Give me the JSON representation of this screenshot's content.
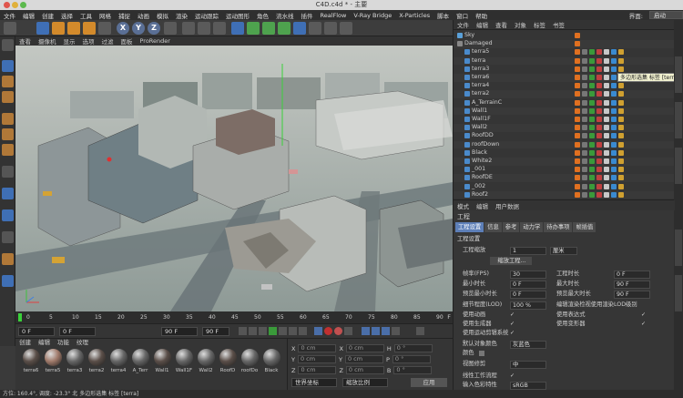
{
  "window": {
    "title": "C4D.c4d * - 主要"
  },
  "menubar": {
    "items": [
      "文件",
      "编辑",
      "创建",
      "选择",
      "工具",
      "网格",
      "捕捉",
      "动画",
      "模拟",
      "渲染",
      "运动跟踪",
      "运动图形",
      "角色",
      "流水线",
      "插件",
      "RealFlow",
      "V-Ray Bridge",
      "X-Particles",
      "脚本",
      "窗口",
      "帮助"
    ],
    "layout_label": "界面:",
    "layout_value": "启动"
  },
  "toolbar": {
    "axis_x": "X",
    "axis_y": "Y",
    "axis_z": "Z"
  },
  "viewport": {
    "menu": [
      "查看",
      "摄像机",
      "显示",
      "选项",
      "过滤",
      "面板",
      "ProRender"
    ]
  },
  "timeline": {
    "ticks": [
      "0",
      "5",
      "10",
      "15",
      "20",
      "25",
      "30",
      "35",
      "40",
      "45",
      "50",
      "55",
      "60",
      "65",
      "70",
      "75",
      "80",
      "85",
      "90"
    ],
    "frame_unit": "F"
  },
  "transport": {
    "start": "0 F",
    "current": "0 F",
    "end": "90 F",
    "end2": "90 F"
  },
  "materials": {
    "menu": [
      "创建",
      "编辑",
      "功能",
      "纹理"
    ],
    "items": [
      "terra6",
      "terra5",
      "terra3",
      "terra2",
      "terra4",
      "A_Terr",
      "Wall1",
      "Wall1F",
      "Wall2",
      "RoofD",
      "roofDo",
      "Black"
    ]
  },
  "coords": {
    "rows": [
      {
        "l1": "X",
        "v1": "0 cm",
        "l2": "X",
        "v2": "0 cm",
        "l3": "H",
        "v3": "0 °"
      },
      {
        "l1": "Y",
        "v1": "0 cm",
        "l2": "Y",
        "v2": "0 cm",
        "l3": "P",
        "v3": "0 °"
      },
      {
        "l1": "Z",
        "v1": "0 cm",
        "l2": "Z",
        "v2": "0 cm",
        "l3": "B",
        "v3": "0 °"
      }
    ],
    "mode": "世界坐标",
    "scale_mode": "缩放比例",
    "apply": "应用"
  },
  "objects": {
    "menu": [
      "文件",
      "编辑",
      "查看",
      "对象",
      "标签",
      "书签"
    ],
    "rows": [
      {
        "name": "Sky",
        "indent": 0
      },
      {
        "name": "Damaged",
        "indent": 0
      },
      {
        "name": "terra5",
        "indent": 1
      },
      {
        "name": "terra",
        "indent": 1
      },
      {
        "name": "terra3",
        "indent": 1
      },
      {
        "name": "terra6",
        "indent": 1
      },
      {
        "name": "terra4",
        "indent": 1
      },
      {
        "name": "terra2",
        "indent": 1
      },
      {
        "name": "A_TerrainC",
        "indent": 1
      },
      {
        "name": "Wall1",
        "indent": 1
      },
      {
        "name": "Wall1F",
        "indent": 1
      },
      {
        "name": "Wall2",
        "indent": 1
      },
      {
        "name": "RoofDD",
        "indent": 1
      },
      {
        "name": "roofDown",
        "indent": 1
      },
      {
        "name": "Black",
        "indent": 1
      },
      {
        "name": "White2",
        "indent": 1
      },
      {
        "name": "_001",
        "indent": 1
      },
      {
        "name": "RoofDE",
        "indent": 1
      },
      {
        "name": "_002",
        "indent": 1
      },
      {
        "name": "Roof2",
        "indent": 1
      }
    ],
    "tooltip": "多边形选集 标签 [terra]"
  },
  "attributes": {
    "menu": [
      "模式",
      "编辑",
      "用户数据"
    ],
    "title": "工程",
    "tabs": [
      "工程设置",
      "信息",
      "参考",
      "动力学",
      "待办事项",
      "帧插值"
    ],
    "section": "工程设置",
    "scale_label": "工程缩放",
    "scale_value": "1",
    "scale_unit": "厘米",
    "scale_button": "缩放工程...",
    "fps_label": "帧率(FPS)",
    "fps_value": "30",
    "projtime_label": "工程时长",
    "projtime_value": "0 F",
    "min_label": "最小时长",
    "min_value": "0 F",
    "max_label": "最大时长",
    "max_value": "90 F",
    "pmin_label": "预览最小时长",
    "pmin_value": "0 F",
    "pmax_label": "预览最大时长",
    "pmax_value": "90 F",
    "lod_label": "细节程度(LOD)",
    "lod_value": "100 %",
    "lod_editor": "编辑渲染检视使用渲染LOD级别",
    "anim_label": "使用动画",
    "expr_label": "使用表达式",
    "gen_label": "使用生成器",
    "deform_label": "使用变形器",
    "motion_label": "使用运动剪辑系统",
    "objcolor_label": "默认对象颜色",
    "objcolor_value": "灰蓝色",
    "color_label": "颜色",
    "clip_label": "视图修剪",
    "clip_value": "中",
    "linear_label": "线性工作流程",
    "input_label": "输入色彩特性",
    "input_value": "sRGB"
  },
  "status": {
    "text": "方位: 160.4°, 调度: -23.3° 北 多边形选集 标签 [terra]"
  }
}
